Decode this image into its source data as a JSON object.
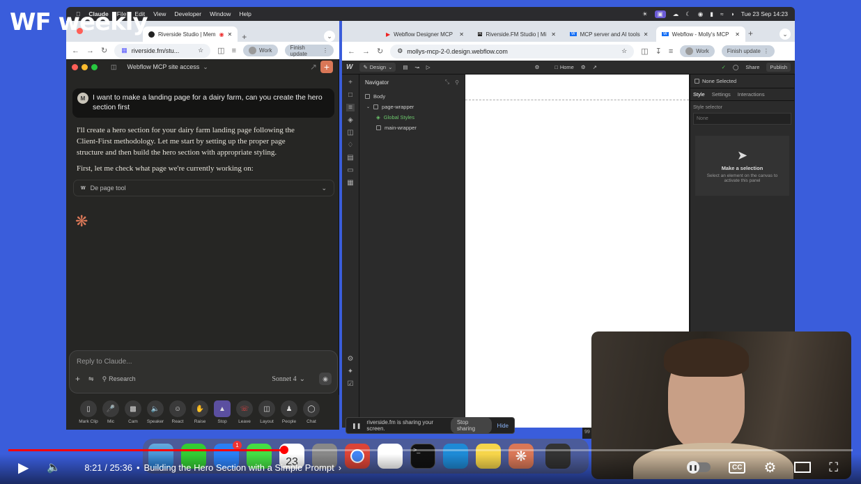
{
  "logo": {
    "text": "WF weekly"
  },
  "macbar": {
    "app": "Claude",
    "menus": [
      "File",
      "Edit",
      "View",
      "Developer",
      "Window",
      "Help"
    ],
    "datetime": "Tue 23 Sep  14:23"
  },
  "left_browser": {
    "tab_title": "Riverside Studio | Mem",
    "url": "riverside.fm/stu...",
    "profile": "Work",
    "finish": "Finish update"
  },
  "claude": {
    "title": "Webflow MCP site access",
    "user_avatar": "M",
    "user_message": "I want to make a landing page for a dairy farm, can you create the hero section first",
    "reply_1": "I'll create a hero section for your dairy farm landing page following the Client-First methodology. Let me start by setting up the proper page structure and then build the hero section with appropriate styling.",
    "reply_2": "First, let me check what page we're currently working on:",
    "tool_name": "De page tool",
    "composer_placeholder": "Reply to Claude...",
    "research": "Research",
    "model": "Sonnet 4"
  },
  "riverside": {
    "controls": [
      "Mark Clip",
      "Mic",
      "Cam",
      "Speaker",
      "React",
      "Raise",
      "Stop",
      "Leave",
      "Layout",
      "People",
      "Chat"
    ]
  },
  "right_browser": {
    "tabs": [
      "Webflow Designer MCP",
      "Riverside.FM Studio | Mi",
      "MCP server and AI tools",
      "Webflow - Molly's MCP"
    ],
    "url": "mollys-mcp-2-0.design.webflow.com",
    "profile": "Work",
    "finish": "Finish update"
  },
  "webflow": {
    "mode": "Design",
    "page": "Home",
    "share": "Share",
    "publish": "Publish",
    "navigator": "Navigator",
    "nav_items": [
      "Body",
      "page-wrapper",
      "Global Styles",
      "main-wrapper"
    ],
    "none_selected": "None Selected",
    "panel_tabs": [
      "Style",
      "Settings",
      "Interactions"
    ],
    "style_selector": "Style selector",
    "selector_value": "None",
    "make_selection": "Make a selection",
    "make_selection_sub": "Select an element on the canvas to activate this panel",
    "width_partial": "99"
  },
  "sharing": {
    "text": "riverside.fm is sharing your screen.",
    "stop": "Stop sharing",
    "hide": "Hide"
  },
  "dock": {
    "mail_badge": "1",
    "calendar_day": "23"
  },
  "player": {
    "time": "8:21 / 25:36",
    "chapter": "Building the Hero Section with a Simple Prompt",
    "cc": "CC",
    "progress": 0.327
  },
  "colors": {
    "accent_claude": "#d97757",
    "webflow_publish": "#3a3a3a",
    "yt_red": "#ff0000"
  }
}
